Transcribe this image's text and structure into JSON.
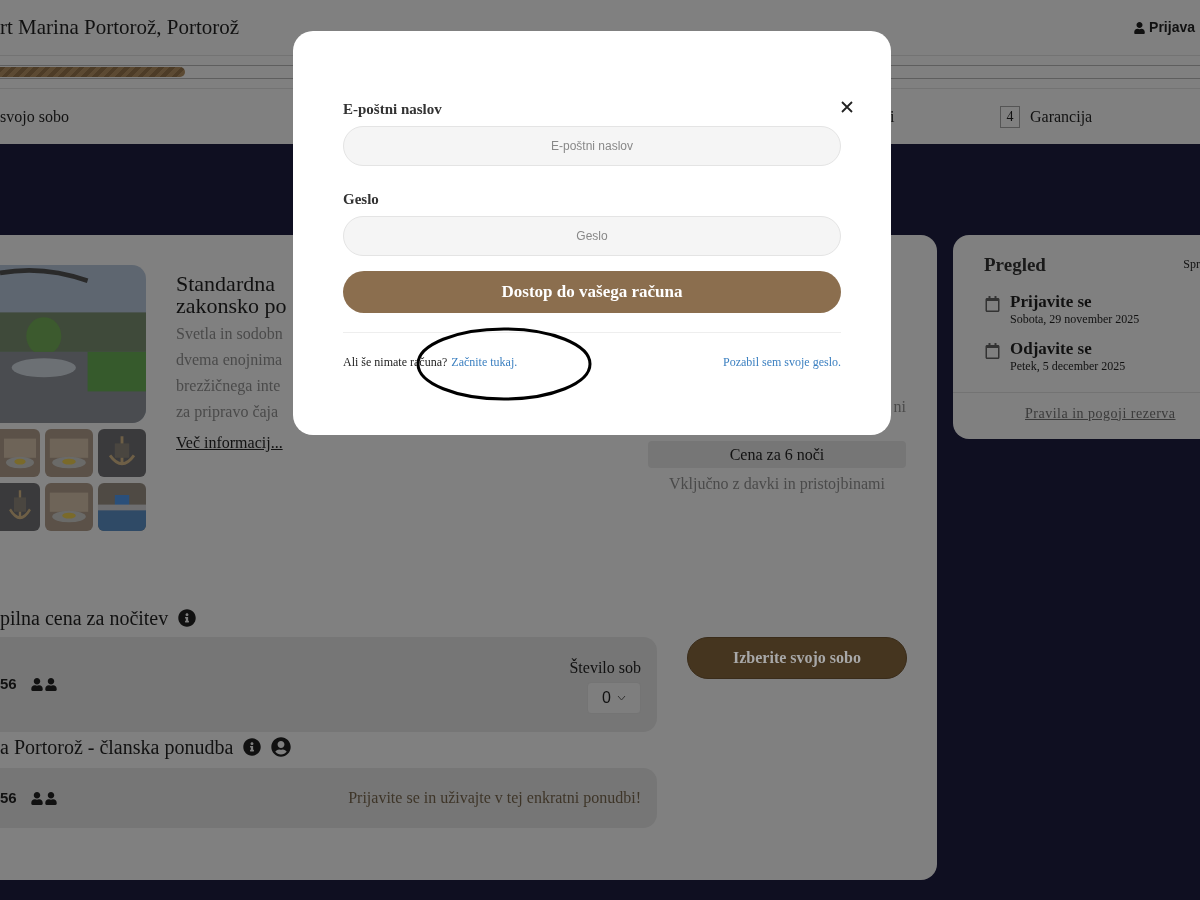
{
  "header": {
    "title": "rt Marina Portorož, Portorož",
    "login": "Prijava"
  },
  "progress": {
    "level": 0.154
  },
  "steps": [
    {
      "label": "svojo sobo"
    },
    {
      "label": "i"
    },
    {
      "number": "4",
      "label": "Garancija"
    }
  ],
  "room": {
    "title_lines": [
      "Standardna",
      "zakonsko po"
    ],
    "description_lines": [
      "Svetla in sodobn",
      "dvema enojnima",
      "brezžičnega inte",
      "za pripravo čaja"
    ],
    "more_link": "Več informacij...",
    "side_fragment": "ni",
    "price_label": "Cena za 6 noči",
    "price_note": "Vključno z davki in pristojbinami"
  },
  "rates": [
    {
      "title": "pilna cena za nočitev",
      "has_info": true,
      "amount": "56",
      "rooms_label": "Število sob",
      "rooms_value": "0",
      "button": "Izberite svojo sobo"
    },
    {
      "title": "a Portorož - članska ponudba",
      "has_info": true,
      "has_account": true,
      "amount": "56",
      "member_note": "Prijavite se in uživajte v tej enkratni ponudbi!"
    }
  ],
  "summary": {
    "title": "Pregled",
    "edit": "Spr",
    "items": [
      {
        "label": "Prijavite se",
        "date": "Sobota, 29 november 2025"
      },
      {
        "label": "Odjavite se",
        "date": "Petek, 5 december 2025"
      }
    ],
    "terms_link": "Pravila in pogoji rezerva"
  },
  "login_modal": {
    "email_label": "E-poštni naslov",
    "email_placeholder": "E-poštni naslov",
    "password_label": "Geslo",
    "password_placeholder": "Geslo",
    "submit": "Dostop do vašega računa",
    "no_account": "Ali še nimate računa?",
    "signup_link": "Začnite tukaj.",
    "forgot_link": "Pozabil sem svoje geslo."
  }
}
